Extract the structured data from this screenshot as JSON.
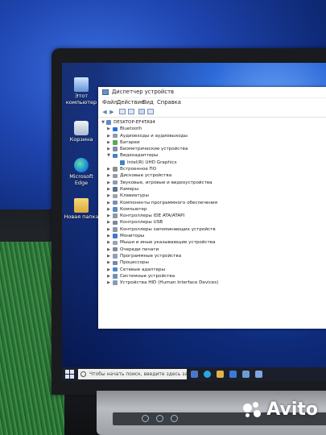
{
  "desktop": {
    "icons": [
      {
        "label": "Этот компьютер",
        "icon": "computer-icon"
      },
      {
        "label": "Корзина",
        "icon": "recycle-bin-icon"
      },
      {
        "label": "Microsoft Edge",
        "icon": "edge-icon"
      },
      {
        "label": "Новая папка",
        "icon": "folder-icon"
      }
    ]
  },
  "window": {
    "title": "Диспетчер устройств",
    "menu": [
      "Файл",
      "Действие",
      "Вид",
      "Справка"
    ],
    "root": "DESKTOP-EF4TA94",
    "tree": [
      {
        "label": "Bluetooth",
        "icon": "bluetooth-icon",
        "expanded": false
      },
      {
        "label": "Аудиовходы и аудиовыходы",
        "icon": "speaker-icon",
        "expanded": false
      },
      {
        "label": "Батареи",
        "icon": "battery-icon",
        "expanded": false
      },
      {
        "label": "Биометрические устройства",
        "icon": "fingerprint-icon",
        "expanded": false
      },
      {
        "label": "Видеоадаптеры",
        "icon": "display-adapter-icon",
        "expanded": true,
        "children": [
          {
            "label": "Intel(R) UHD Graphics",
            "icon": "display-adapter-icon"
          }
        ]
      },
      {
        "label": "Встроенное ПО",
        "icon": "firmware-icon",
        "expanded": false
      },
      {
        "label": "Дисковые устройства",
        "icon": "disk-icon",
        "expanded": false
      },
      {
        "label": "Звуковые, игровые и видеоустройства",
        "icon": "speaker-icon",
        "expanded": false
      },
      {
        "label": "Камеры",
        "icon": "camera-icon",
        "expanded": false
      },
      {
        "label": "Клавиатуры",
        "icon": "keyboard-icon",
        "expanded": false
      },
      {
        "label": "Компоненты программного обеспечения",
        "icon": "component-icon",
        "expanded": false
      },
      {
        "label": "Компьютер",
        "icon": "computer-icon",
        "expanded": false
      },
      {
        "label": "Контроллеры IDE ATA/ATAPI",
        "icon": "controller-icon",
        "expanded": false
      },
      {
        "label": "Контроллеры USB",
        "icon": "usb-icon",
        "expanded": false
      },
      {
        "label": "Контроллеры запоминающих устройств",
        "icon": "storage-controller-icon",
        "expanded": false
      },
      {
        "label": "Мониторы",
        "icon": "monitor-icon",
        "expanded": false
      },
      {
        "label": "Мыши и иные указывающие устройства",
        "icon": "mouse-icon",
        "expanded": false
      },
      {
        "label": "Очереди печати",
        "icon": "printer-icon",
        "expanded": false
      },
      {
        "label": "Программные устройства",
        "icon": "software-device-icon",
        "expanded": false
      },
      {
        "label": "Процессоры",
        "icon": "processor-icon",
        "expanded": false
      },
      {
        "label": "Сетевые адаптеры",
        "icon": "network-adapter-icon",
        "expanded": false
      },
      {
        "label": "Системные устройства",
        "icon": "system-device-icon",
        "expanded": false
      },
      {
        "label": "Устройства HID (Human Interface Devices)",
        "icon": "hid-icon",
        "expanded": false
      }
    ]
  },
  "taskbar": {
    "search_placeholder": "Чтобы начать поиск, введите здесь запрос"
  },
  "watermark": "Avito",
  "colors": {
    "accent": "#0a64c8",
    "wallpaper": "#2d69d8"
  }
}
